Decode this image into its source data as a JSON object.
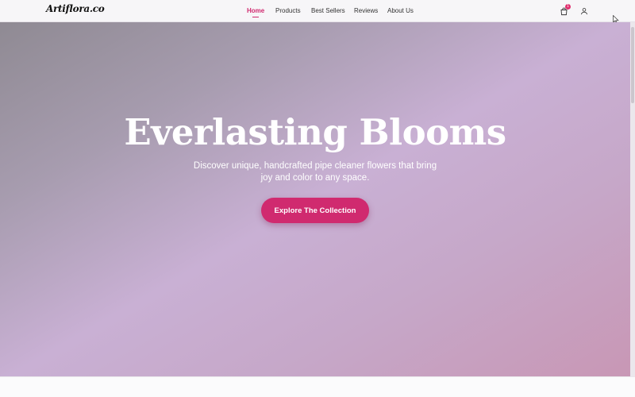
{
  "brand": {
    "logo_text": "Artiflora.co"
  },
  "nav": {
    "items": [
      {
        "label": "Home",
        "active": true
      },
      {
        "label": "Products",
        "active": false
      },
      {
        "label": "Best Sellers",
        "active": false
      },
      {
        "label": "Reviews",
        "active": false
      },
      {
        "label": "About Us",
        "active": false
      }
    ],
    "cart_count": "1",
    "icons": [
      "shopping-bag-icon",
      "user-icon",
      "cursor-pointer-icon"
    ]
  },
  "hero": {
    "title": "Everlasting Blooms",
    "subtitle": "Discover unique, handcrafted pipe cleaner flowers that bring joy and color to any space.",
    "cta_label": "Explore The Collection"
  },
  "colors": {
    "accent": "#d02a6f",
    "badge": "#e0306f",
    "hero_gradient_start": "#8f8a93",
    "hero_gradient_mid": "#c9b0d4",
    "hero_gradient_end": "#c897b5"
  }
}
